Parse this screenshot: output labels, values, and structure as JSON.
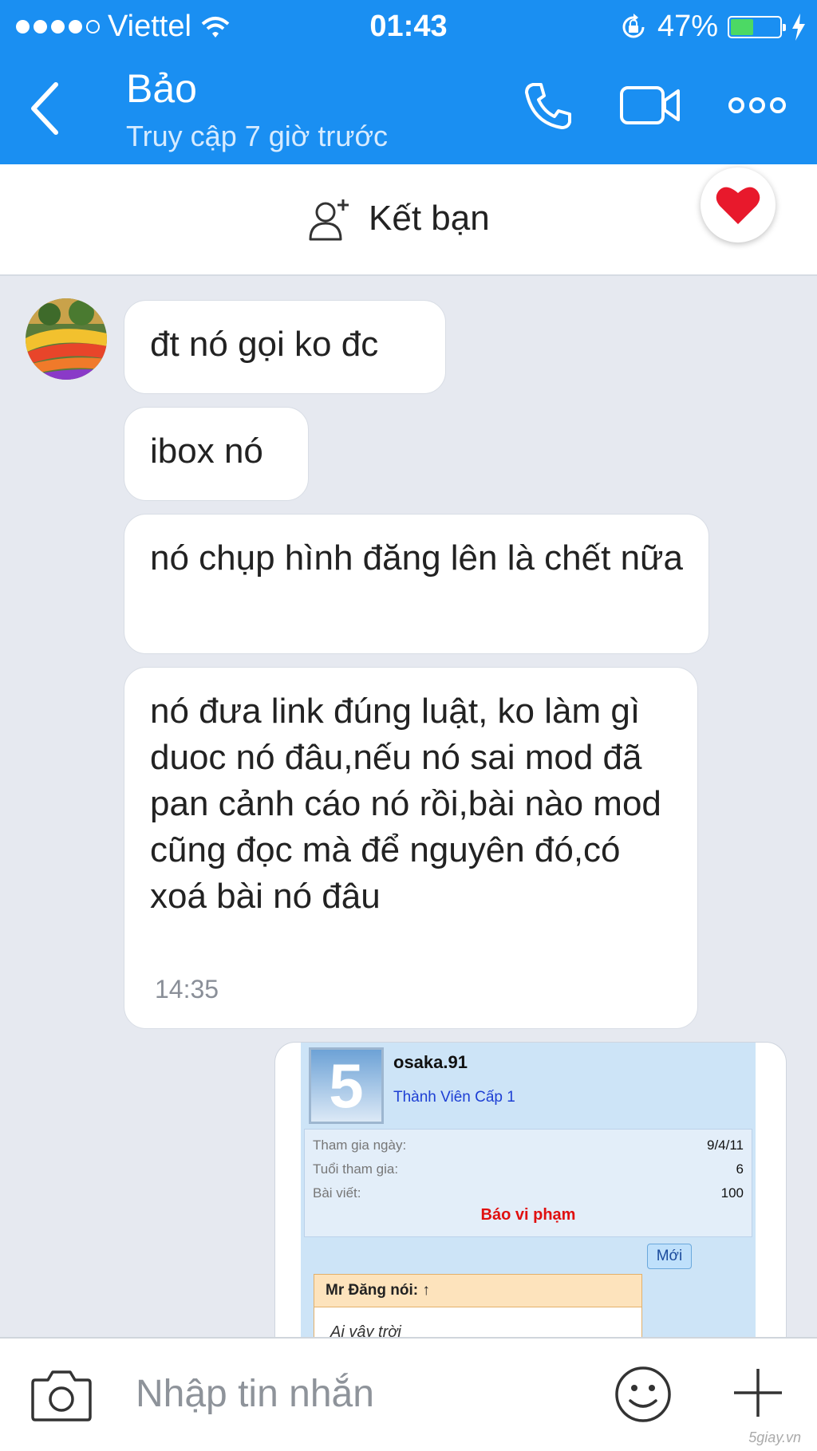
{
  "status_bar": {
    "carrier": "Viettel",
    "time": "01:43",
    "battery": "47%",
    "battery_level": 0.47,
    "icons": [
      "signal-dots-icon",
      "wifi-icon",
      "orientation-lock-icon",
      "battery-icon",
      "charging-icon"
    ]
  },
  "header": {
    "title": "Bảo",
    "subtitle": "Truy cập 7 giờ trước",
    "icons": [
      "back-icon",
      "phone-icon",
      "video-call-icon",
      "more-icon"
    ]
  },
  "add_friend": {
    "label": "Kết bạn",
    "icon": "add-person-icon"
  },
  "reaction": {
    "icon": "heart-icon",
    "color": "#e8192c"
  },
  "messages": [
    {
      "text": "đt nó gọi ko đc"
    },
    {
      "text": "ibox nó"
    },
    {
      "text": "nó chụp hình đăng lên là chết nữa"
    },
    {
      "text": "nó đưa link đúng luật, ko làm gì duoc nó đâu,nếu nó sai mod đã pan cảnh cáo nó rồi,bài nào mod cũng đọc mà để nguyên đó,có xoá bài nó đâu",
      "time": "14:35"
    }
  ],
  "image_message": {
    "rank_number": "5",
    "username": "osaka.91",
    "rank": "Thành Viên Cấp 1",
    "rows": [
      {
        "label": "Tham gia ngày:",
        "value": "9/4/11"
      },
      {
        "label": "Tuổi tham gia:",
        "value": "6"
      },
      {
        "label": "Bài viết:",
        "value": "100"
      }
    ],
    "report": "Báo vi phạm",
    "new_badge": "Mới",
    "quote_header": "Mr Đăng nói: ↑",
    "quote_text": "Ai vậy trời"
  },
  "composer": {
    "placeholder": "Nhập tin nhắn",
    "icons": [
      "camera-icon",
      "emoji-icon",
      "plus-icon"
    ]
  },
  "watermark": "5giay.vn",
  "colors": {
    "accent": "#1a8ff2",
    "background": "#e6e9f0",
    "bubble": "#ffffff"
  }
}
